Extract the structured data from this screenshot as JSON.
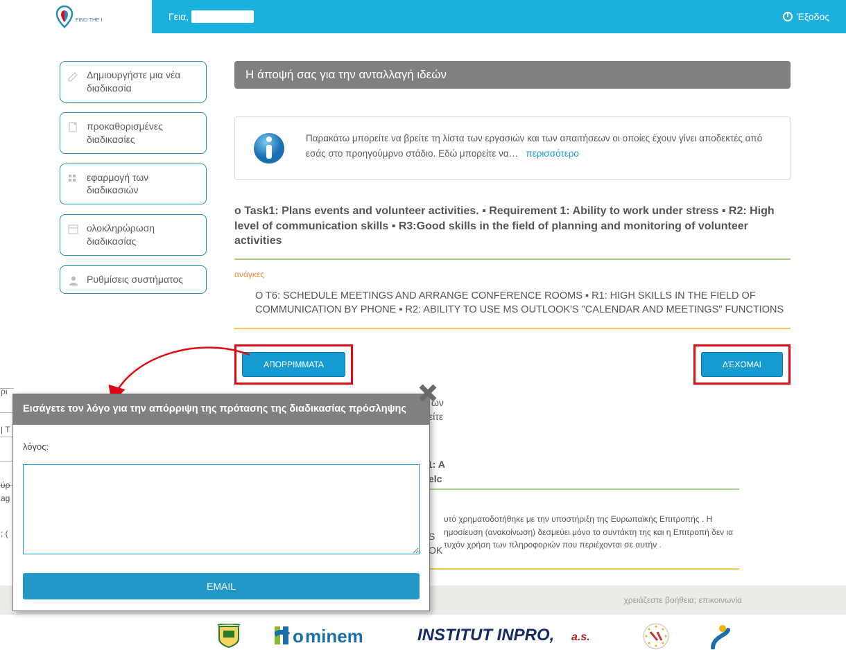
{
  "header": {
    "logo_text": "FIND THE BEST",
    "greeting": "Γεια,",
    "logout": "Έξοδος"
  },
  "sidebar": {
    "items": [
      {
        "label": "Δημιουργήστε μια νέα διαδικασία"
      },
      {
        "label": "προκαθορισμένες διαδικασίες"
      },
      {
        "label": "εφαρμογή των διαδικασιών"
      },
      {
        "label": "ολοκληρώρωση διαδικασίας"
      },
      {
        "label": "Ρυθμίσεις συστήματος"
      }
    ]
  },
  "main": {
    "title": "Η άποψή σας για την ανταλλαγή ιδεών",
    "info_text": "Παρακάτω μπορείτε να βρείτε τη λίστα των εργασιών και των απαιτήσεων οι οποίες έχουν γίνει αποδεκτές από εσάς στο προηγούμρνο στάδιο. Εδώ μπορείτε να…",
    "info_more": "περισσότερο",
    "task_title": "ο Task1: Plans events and volunteer activities. ▪ Requirement 1: Ability to work under stress ▪ R2: High level of communication skills ▪ R3:Good skills in the field of planning and monitoring of volunteer activities",
    "needs_label": "ανάγκες",
    "needs_body": "O T6: SCHEDULE MEETINGS AND ARRANGE CONFERENCE ROOMS ▪ R1: HIGH SKILLS IN THE FIELD OF COMMUNICATION BY PHONE ▪ R2: ABILITY TO USE MS OUTLOOK'S \"CALENDAR AND MEETINGS\" FUNCTIONS",
    "reject_btn": "ΑΠΟΡΡΙΜΜΑΤΑ",
    "accept_btn": "ΔΈΧΟΜΑΙ"
  },
  "fragments": {
    "f1": "ων",
    "f2": "είτε",
    "f3": "1: A",
    "f4": "elc",
    "l1": "ρι",
    "l2": "| T",
    "l3": "ύρ",
    "l4": "ag",
    "l5": "; ("
  },
  "disclaimer": "υτό χρηματοδοτήθηκε με την υποστήριξη της Ευρωπαϊκής Επιτροπής . Η ημοσίευση (ανακοίνωση) δεσμεύει μόνο το συντάκτη της και η Επιτροπή δεν ια τυχόν χρήση των πληροφοριών που περιέχονται σε αυτήν .",
  "footer": {
    "help": "χρειάζεστε βοήθεια; επικοινωνία"
  },
  "modal": {
    "title": "Εισάγετε τον λόγο για την απόρριψη της πρότασης της διαδικασίας πρόσληψης",
    "reason_label": "λόγος:",
    "send": "EMAIL"
  },
  "partners": {
    "p1": "Hominem",
    "p2": "INSTITUT INPRO, a.s."
  }
}
